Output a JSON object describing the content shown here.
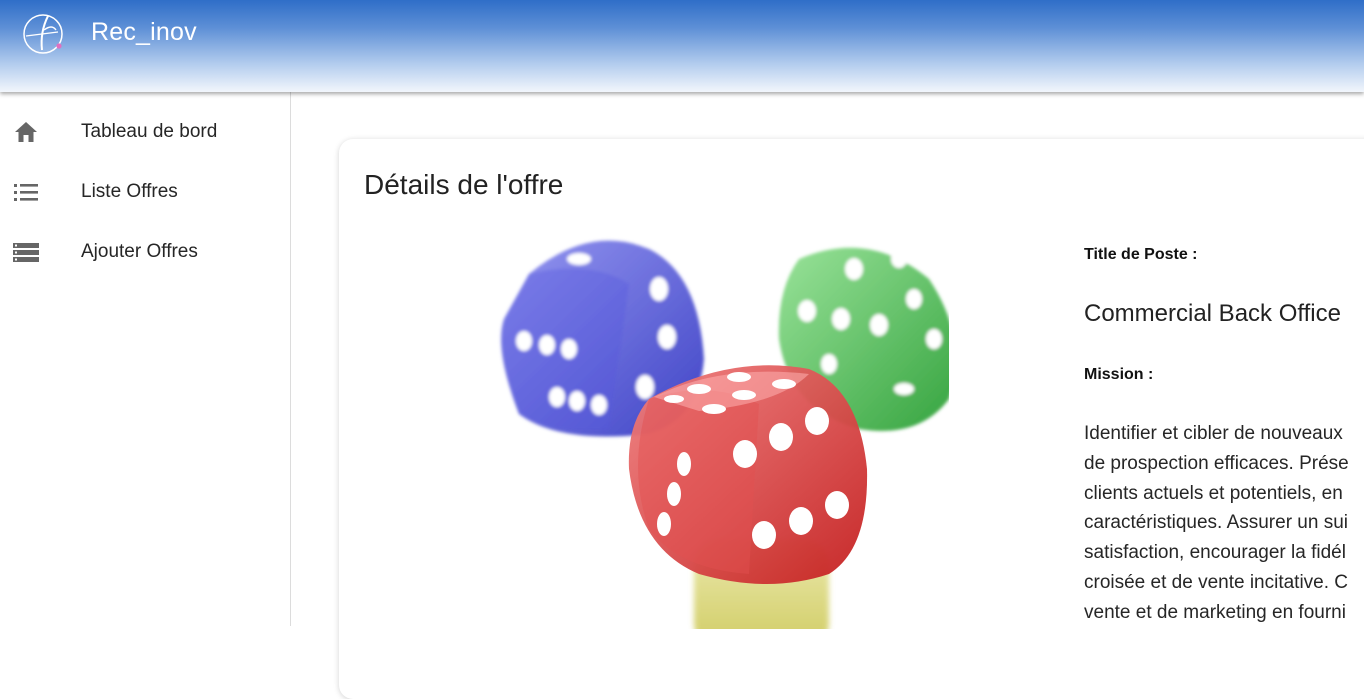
{
  "header": {
    "app_title": "Rec_inov",
    "logo_icon": "brand-logo-icon",
    "gradient_top": "#2f6ec8",
    "gradient_bottom": "#f2f6fc"
  },
  "sidebar": {
    "items": [
      {
        "label": "Tableau de bord",
        "icon": "home-icon"
      },
      {
        "label": "Liste Offres",
        "icon": "list-icon"
      },
      {
        "label": "Ajouter Offres",
        "icon": "storage-list-icon"
      }
    ]
  },
  "offer": {
    "page_title": "Détails de l'offre",
    "image": "dice-image",
    "title_label": "Title de Poste :",
    "title_value": "Commercial Back Office",
    "mission_label": "Mission :",
    "mission_lines": [
      "Identifier et cibler de nouveaux",
      "de prospection efficaces. Prése",
      "clients actuels et potentiels, en",
      "caractéristiques. Assurer un sui",
      "satisfaction, encourager la fidél",
      "croisée et de vente incitative. C",
      "vente et de marketing en fourni"
    ]
  }
}
